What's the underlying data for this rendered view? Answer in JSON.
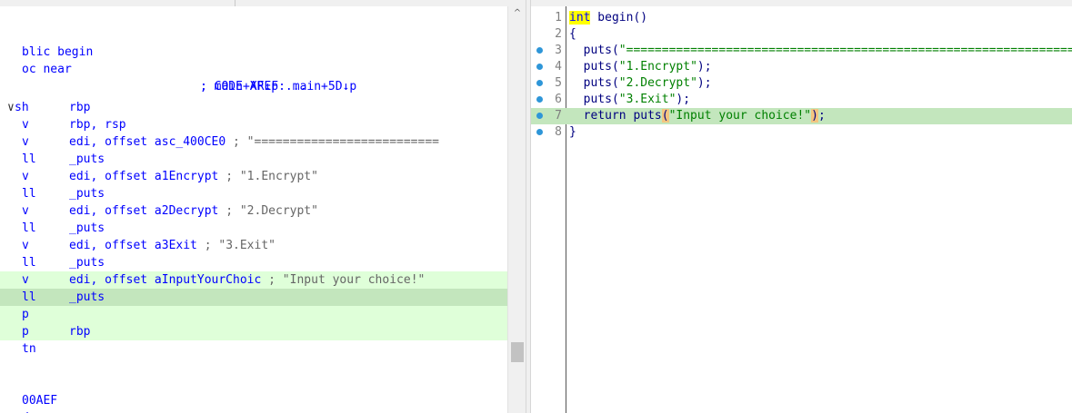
{
  "disassembly": {
    "header": {
      "public_label": "blic begin",
      "proc_label": "oc near",
      "xref_line1": "; CODE XREF: main+5D↓p",
      "xref_line2": "; main+AF↓p ..."
    },
    "caret": "∨",
    "lines": [
      {
        "mn": "sh",
        "op": "rbp",
        "comment": ""
      },
      {
        "mn": "v",
        "op": "rbp, rsp",
        "comment": ""
      },
      {
        "mn": "v",
        "op": "edi, offset asc_400CE0",
        "comment": " ; \"=========================="
      },
      {
        "mn": "ll",
        "op": "_puts",
        "comment": ""
      },
      {
        "mn": "v",
        "op": "edi, offset a1Encrypt",
        "comment": " ; \"1.Encrypt\""
      },
      {
        "mn": "ll",
        "op": "_puts",
        "comment": ""
      },
      {
        "mn": "v",
        "op": "edi, offset a2Decrypt",
        "comment": " ; \"2.Decrypt\""
      },
      {
        "mn": "ll",
        "op": "_puts",
        "comment": ""
      },
      {
        "mn": "v",
        "op": "edi, offset a3Exit",
        "comment": " ; \"3.Exit\""
      },
      {
        "mn": "ll",
        "op": "_puts",
        "comment": ""
      },
      {
        "mn": "v",
        "op": "edi, offset aInputYourChoic",
        "comment": " ; \"Input your choice!\""
      },
      {
        "mn": "ll",
        "op": "_puts",
        "comment": ""
      },
      {
        "mn": "p",
        "op": "",
        "comment": ""
      },
      {
        "mn": "p",
        "op": "rbp",
        "comment": ""
      },
      {
        "mn": "tn",
        "op": "",
        "comment": ""
      }
    ],
    "tail": [
      "00AEF",
      "dp"
    ]
  },
  "scrollbar": {
    "up_arrow": "^"
  },
  "pseudocode": {
    "lines": [
      {
        "num": "1",
        "dot": false,
        "kw": "int",
        "text": " begin()"
      },
      {
        "num": "2",
        "dot": false,
        "text": "{"
      },
      {
        "num": "3",
        "dot": true,
        "pre": "  puts(",
        "str": "\"=======================================================================",
        "post": ""
      },
      {
        "num": "4",
        "dot": true,
        "pre": "  puts(",
        "str": "\"1.Encrypt\"",
        "post": ");"
      },
      {
        "num": "5",
        "dot": true,
        "pre": "  puts(",
        "str": "\"2.Decrypt\"",
        "post": ");"
      },
      {
        "num": "6",
        "dot": true,
        "pre": "  puts(",
        "str": "\"3.Exit\"",
        "post": ");"
      },
      {
        "num": "7",
        "dot": true,
        "pre": "  return puts",
        "paren1": "(",
        "str": "\"Input your choice!\"",
        "paren2": ")",
        "post": ";"
      },
      {
        "num": "8",
        "dot": true,
        "text": "}"
      }
    ]
  },
  "colors": {
    "highlight_light": "#dfffd9",
    "highlight_dark": "#c3e6bd",
    "breakpoint_dot": "#2e96d8",
    "keyword_highlight": "#ffff00"
  }
}
